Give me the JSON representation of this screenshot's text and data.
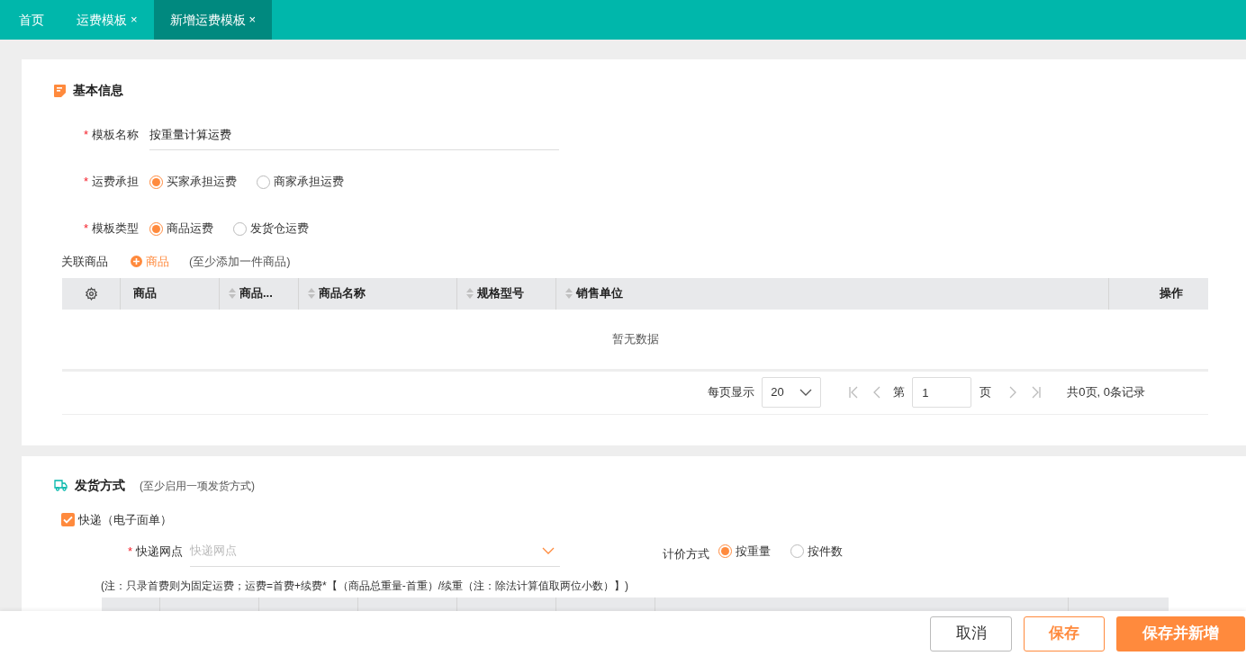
{
  "tabs": [
    {
      "label": "首页",
      "selected": false
    },
    {
      "label": "运费模板",
      "close": "×",
      "selected": false
    },
    {
      "label": "新增运费模板",
      "close": "×",
      "selected": true
    }
  ],
  "basic_info": {
    "title": "基本信息",
    "fields": [
      {
        "kind": "text",
        "label": "模板名称",
        "required_mark": "*",
        "value": "按重量计算运费"
      },
      {
        "kind": "radio",
        "label": "运费承担",
        "required_mark": "*",
        "options": [
          {
            "label": "买家承担运费",
            "selected": true
          },
          {
            "label": "商家承担运费",
            "selected": false
          }
        ]
      },
      {
        "kind": "radio",
        "label": "模板类型",
        "required_mark": "*",
        "options": [
          {
            "label": "商品运费",
            "selected": true
          },
          {
            "label": "发货仓运费",
            "selected": false
          }
        ]
      }
    ],
    "related_products": {
      "label": "关联商品",
      "add_button": "商品",
      "hint": "(至少添加一件商品)",
      "table": {
        "columns": [
          {
            "label": "商品",
            "sortable": false
          },
          {
            "label": "商品...",
            "sortable": true
          },
          {
            "label": "商品名称",
            "sortable": true
          },
          {
            "label": "规格型号",
            "sortable": true
          },
          {
            "label": "销售单位",
            "sortable": true
          },
          {
            "label": "操作",
            "sortable": false
          }
        ],
        "empty_text": "暂无数据"
      },
      "pagination": {
        "per_page_label": "每页显示",
        "per_page_value": "20",
        "page_prefix": "第",
        "page_value": "1",
        "page_suffix": "页",
        "summary": "共0页, 0条记录"
      }
    }
  },
  "shipping": {
    "title": "发货方式",
    "hint": "(至少启用一项发货方式)",
    "express": {
      "label": "快递（电子面单）",
      "checked": true
    },
    "outlet": {
      "label": "快递网点",
      "required_mark": "*",
      "placeholder": "快递网点"
    },
    "pricing": {
      "label": "计价方式",
      "options": [
        {
          "label": "按重量",
          "selected": true
        },
        {
          "label": "按件数",
          "selected": false
        }
      ]
    },
    "note": "(注：只录首费则为固定运费；运费=首费+续费*【（商品总重量-首重）/续重（注：除法计算值取两位小数）】)"
  },
  "footer_buttons": [
    {
      "label": "取消",
      "kind": "default"
    },
    {
      "label": "保存",
      "kind": "outline"
    },
    {
      "label": "保存并新增",
      "kind": "primary"
    }
  ]
}
